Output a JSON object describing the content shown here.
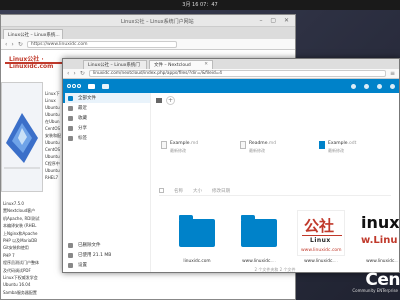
{
  "topbar": {
    "clock": "3月 16 07：47"
  },
  "back_window": {
    "title": "Linux公社 – Linux系统门户网站",
    "tab": "Linux公社 – Linux系统...",
    "url": "https://www.linuxidc.com",
    "logo_text": "Linux公社 · Linuxidc.com",
    "list_a": [
      "Linux下",
      "Linux",
      "Ubuntu",
      "Ubuntu",
      "在Ubun",
      "CentOS",
      "安装和配",
      "Ubuntu",
      "CentOS",
      "Ubuntu",
      "C程序中",
      "Ubuntu",
      "RHEL7"
    ],
    "list_b": [
      "Linux7.5.0",
      "置Nextcloud客户",
      "机Apache, RDI测试",
      "本编译安装 (RHEL",
      "上Nginx和Apache",
      "PHP 以及MariaDB",
      "Git安装和使用",
      "PHP 7",
      "程序员测试门户整体",
      "及代码调试PDF",
      "Linux下权威发学会",
      "Ubuntu 16.04",
      "Samba服务器配置"
    ]
  },
  "front_window": {
    "tab1": "Linux公社 – Linux系统门",
    "tab2": "文件 – Nextcloud",
    "url": "linuxidc.com/nextcloud/index.php/apps/files/?dir=/&fileid=4",
    "sidebar": {
      "items": [
        {
          "label": "全部文件",
          "icon": "folder-icon",
          "selected": true
        },
        {
          "label": "最近",
          "icon": "clock-icon",
          "selected": false
        },
        {
          "label": "收藏",
          "icon": "star-icon",
          "selected": false
        },
        {
          "label": "分享",
          "icon": "share-icon",
          "selected": false
        },
        {
          "label": "标签",
          "icon": "tag-icon",
          "selected": false
        }
      ],
      "bottom": [
        {
          "label": "已删除文件",
          "icon": "trash-icon"
        },
        {
          "label": "已使用 21.1 MB",
          "icon": "storage-icon"
        },
        {
          "label": "设置",
          "icon": "settings-icon"
        }
      ]
    },
    "recent_files": [
      {
        "name": "Example",
        "ext": ".md",
        "sub": "最新修改"
      },
      {
        "name": "Readme",
        "ext": ".md",
        "sub": "最新修改"
      },
      {
        "name": "Example",
        "ext": ".odt",
        "sub": "最新修改"
      }
    ],
    "sort": {
      "name": "名称",
      "size": "大小",
      "modified": "修改日期"
    },
    "tiles": [
      {
        "name": "linuxidc.com",
        "dots": "",
        "kind": "folder"
      },
      {
        "name": "www.linuxidc.",
        "dots": "...",
        "kind": "folder"
      },
      {
        "name": "www.linuxidc.",
        "dots": "...",
        "kind": "image-1"
      },
      {
        "name": "www.linuxidc.",
        "dots": "...",
        "kind": "image-2"
      }
    ],
    "image1": {
      "big": "公社",
      "sm": "Linux",
      "url": "www.linuxidc.com"
    },
    "image2": {
      "big": "inux",
      "sub": "w.Linu"
    },
    "summary": "2 个文件夹和 2 个文件",
    "accent": "#0082c9"
  },
  "desktop": {
    "brand": "Cen",
    "brand_sub": "Community ENTerprise"
  }
}
